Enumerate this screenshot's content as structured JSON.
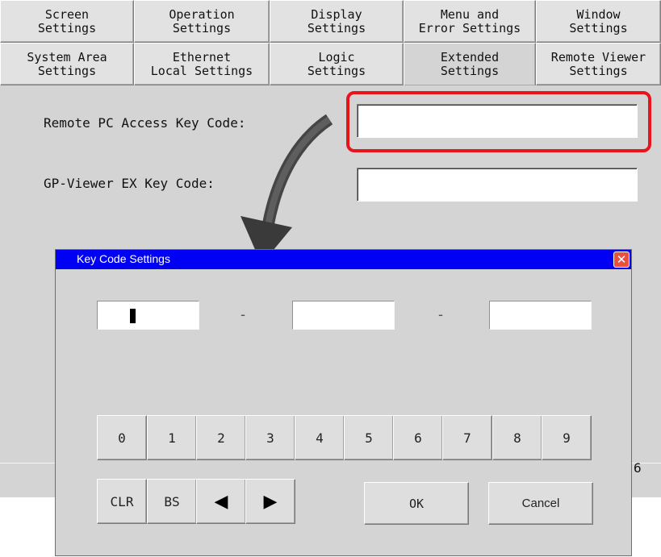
{
  "tabs": {
    "row1": [
      {
        "label": "Screen\nSettings"
      },
      {
        "label": "Operation\nSettings"
      },
      {
        "label": "Display\nSettings"
      },
      {
        "label": "Menu and\nError Settings"
      },
      {
        "label": "Window\nSettings"
      }
    ],
    "row2": [
      {
        "label": "System Area\nSettings"
      },
      {
        "label": "Ethernet\nLocal Settings"
      },
      {
        "label": "Logic\nSettings"
      },
      {
        "label": "Extended\nSettings"
      },
      {
        "label": "Remote Viewer\nSettings"
      }
    ]
  },
  "form": {
    "remote_pc_label": "Remote PC Access Key Code:",
    "gp_viewer_label": "GP-Viewer EX Key Code:",
    "remote_pc_value": "",
    "gp_viewer_value": ""
  },
  "status": {
    "tail": "6"
  },
  "dialog": {
    "title": "Key Code Settings",
    "close_glyph": "✕",
    "dash": "-",
    "digits": [
      "0",
      "1",
      "2",
      "3",
      "4",
      "5",
      "6",
      "7",
      "8",
      "9"
    ],
    "clr": "CLR",
    "bs": "BS",
    "left": "◀",
    "right": "▶",
    "ok": "OK",
    "cancel": "Cancel"
  },
  "colors": {
    "highlight": "#e8141c",
    "titlebar": "#0000f4"
  }
}
